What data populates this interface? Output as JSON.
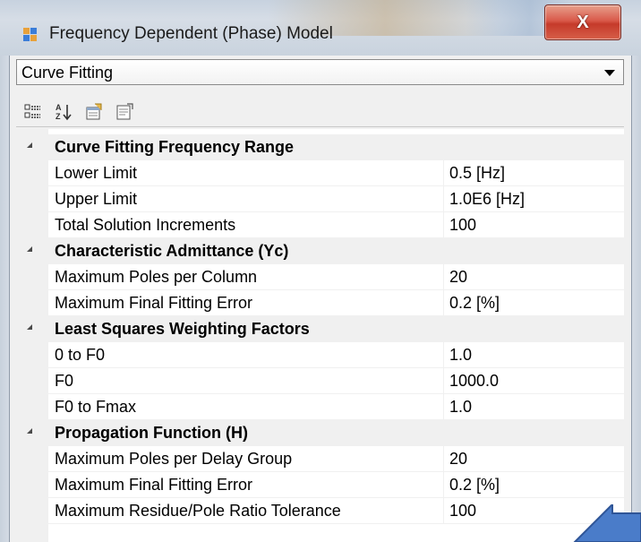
{
  "window": {
    "title": "Frequency Dependent (Phase) Model",
    "close_label": "X"
  },
  "dropdown": {
    "selected": "Curve Fitting"
  },
  "toolbar": {
    "buttons": [
      "categorized-icon",
      "alphabetical-icon",
      "property-pages-icon",
      "events-icon"
    ]
  },
  "property_grid": {
    "rows": [
      {
        "type": "category",
        "label": "Curve Fitting Frequency Range"
      },
      {
        "type": "property",
        "label": "Lower Limit",
        "value": "0.5 [Hz]"
      },
      {
        "type": "property",
        "label": "Upper Limit",
        "value": "1.0E6 [Hz]"
      },
      {
        "type": "property",
        "label": "Total Solution Increments",
        "value": "100"
      },
      {
        "type": "category",
        "label": "Characteristic Admittance (Yc)"
      },
      {
        "type": "property",
        "label": "Maximum Poles per Column",
        "value": "20"
      },
      {
        "type": "property",
        "label": "Maximum Final Fitting Error",
        "value": "0.2 [%]"
      },
      {
        "type": "category",
        "label": "Least Squares Weighting Factors"
      },
      {
        "type": "property",
        "label": "0 to F0",
        "value": "1.0"
      },
      {
        "type": "property",
        "label": "F0",
        "value": "1000.0"
      },
      {
        "type": "property",
        "label": "F0 to Fmax",
        "value": "1.0"
      },
      {
        "type": "category",
        "label": "Propagation Function (H)"
      },
      {
        "type": "property",
        "label": "Maximum Poles per Delay Group",
        "value": "20"
      },
      {
        "type": "property",
        "label": "Maximum Final Fitting Error",
        "value": "0.2 [%]"
      },
      {
        "type": "property",
        "label": "Maximum Residue/Pole Ratio Tolerance",
        "value": "100"
      }
    ]
  },
  "colors": {
    "arrow_fill": "#4a7cc9",
    "arrow_stroke": "#2f5597"
  }
}
